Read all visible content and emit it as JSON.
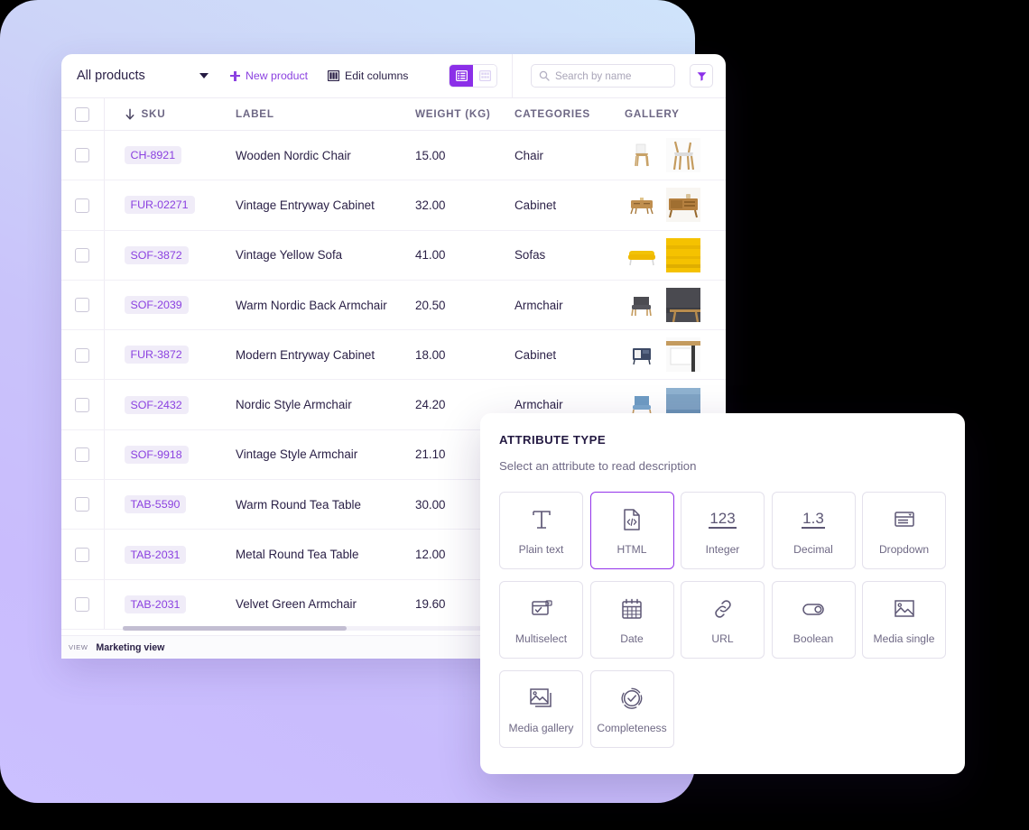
{
  "toolbar": {
    "view_select": "All products",
    "new_product": "New product",
    "edit_columns": "Edit columns",
    "search_placeholder": "Search by name",
    "list_view_icon": "list-view-icon",
    "grid_view_icon": "grid-view-icon",
    "filter_icon": "filter-icon",
    "search_icon": "search-icon",
    "caret_icon": "chevron-down-icon",
    "accent_color": "#8b41e0",
    "active_toggle_bg": "#8b2fe8"
  },
  "table": {
    "columns": [
      "SKU",
      "LABEL",
      "WEIGHT (KG)",
      "CATEGORIES",
      "GALLERY"
    ],
    "sort_column": "SKU",
    "sort_direction": "desc",
    "rows": [
      {
        "sku": "CH-8921",
        "label": "Wooden Nordic Chair",
        "weight": "15.00",
        "category": "Chair"
      },
      {
        "sku": "FUR-02271",
        "label": "Vintage Entryway Cabinet",
        "weight": "32.00",
        "category": "Cabinet"
      },
      {
        "sku": "SOF-3872",
        "label": "Vintage Yellow Sofa",
        "weight": "41.00",
        "category": "Sofas"
      },
      {
        "sku": "SOF-2039",
        "label": "Warm Nordic Back Armchair",
        "weight": "20.50",
        "category": "Armchair"
      },
      {
        "sku": "FUR-3872",
        "label": "Modern Entryway Cabinet",
        "weight": "18.00",
        "category": "Cabinet"
      },
      {
        "sku": "SOF-2432",
        "label": "Nordic Style Armchair",
        "weight": "24.20",
        "category": "Armchair"
      },
      {
        "sku": "SOF-9918",
        "label": "Vintage Style Armchair",
        "weight": "21.10",
        "category": ""
      },
      {
        "sku": "TAB-5590",
        "label": "Warm Round Tea Table",
        "weight": "30.00",
        "category": ""
      },
      {
        "sku": "TAB-2031",
        "label": "Metal Round Tea Table",
        "weight": "12.00",
        "category": ""
      },
      {
        "sku": "TAB-2031",
        "label": "Velvet Green Armchair",
        "weight": "19.60",
        "category": ""
      }
    ],
    "sku_badge_color": "#8b41e0",
    "sku_badge_bg": "#f0ecf8"
  },
  "statusbar": {
    "view_key": "VIEW",
    "view_name": "Marketing view"
  },
  "attribute_panel": {
    "title": "ATTRIBUTE TYPE",
    "subtitle": "Select an attribute to read description",
    "selected": "HTML",
    "selected_border_color": "#9333ea",
    "items": [
      {
        "label": "Plain text",
        "icon": "plain-text-icon"
      },
      {
        "label": "HTML",
        "icon": "html-code-icon"
      },
      {
        "label": "Integer",
        "icon": "integer-123-icon",
        "glyph": "123"
      },
      {
        "label": "Decimal",
        "icon": "decimal-number-icon",
        "glyph": "1.3"
      },
      {
        "label": "Dropdown",
        "icon": "dropdown-icon"
      },
      {
        "label": "Multiselect",
        "icon": "multiselect-icon"
      },
      {
        "label": "Date",
        "icon": "calendar-icon"
      },
      {
        "label": "URL",
        "icon": "link-icon"
      },
      {
        "label": "Boolean",
        "icon": "toggle-icon"
      },
      {
        "label": "Media single",
        "icon": "image-icon"
      },
      {
        "label": "Media gallery",
        "icon": "images-stack-icon"
      },
      {
        "label": "Completeness",
        "icon": "check-circle-icon"
      }
    ]
  }
}
